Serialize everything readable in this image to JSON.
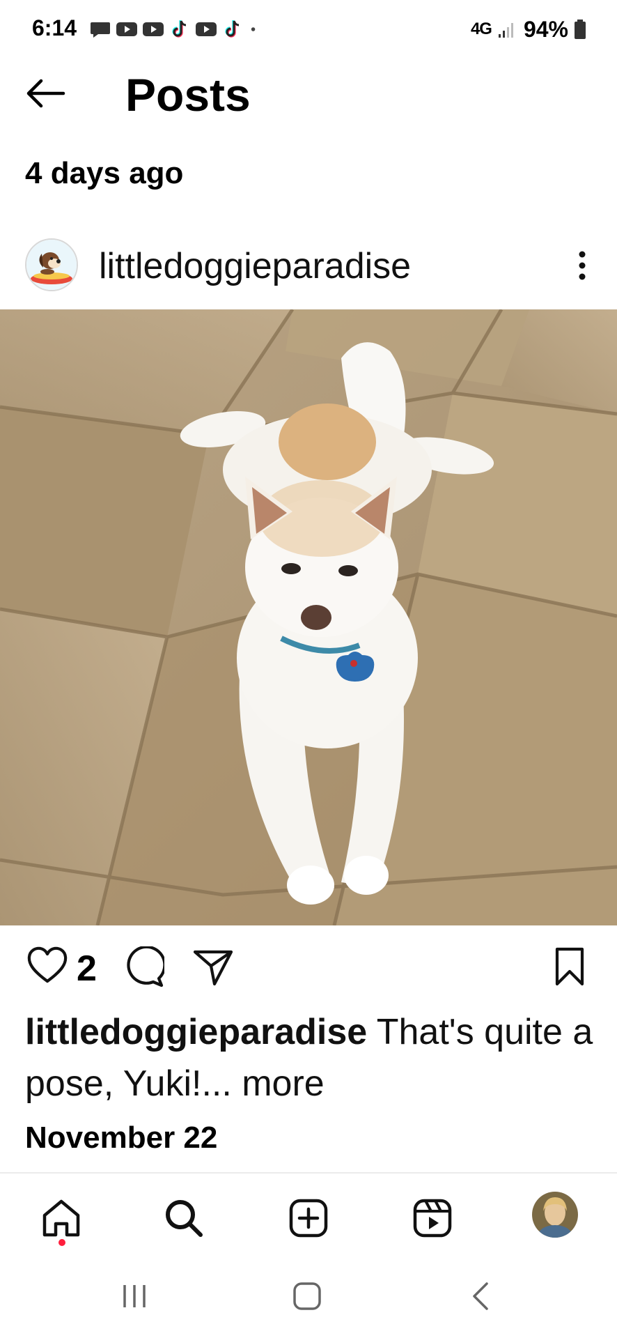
{
  "status_bar": {
    "time": "6:14",
    "network": "4G",
    "battery": "94%",
    "notification_icons": [
      "message-icon",
      "youtube-icon",
      "youtube-icon",
      "tiktok-icon",
      "youtube-icon",
      "tiktok-icon",
      "dot-icon"
    ]
  },
  "header": {
    "title": "Posts",
    "back_icon": "arrow-left-icon"
  },
  "timestamp": "4 days ago",
  "post": {
    "username": "littledoggieparadise",
    "like_count": "2",
    "caption_user": "littledoggieparadise",
    "caption_text": " That's quite a pose, Yuki!...",
    "caption_more": " more",
    "date": "November 22"
  },
  "bottom_nav": {
    "items": [
      "home-icon",
      "search-icon",
      "create-icon",
      "reels-icon",
      "profile-avatar"
    ],
    "active": "home-icon"
  },
  "colors": {
    "text": "#000000",
    "notification_dot": "#ff1f3d",
    "divider": "#ebebeb"
  }
}
